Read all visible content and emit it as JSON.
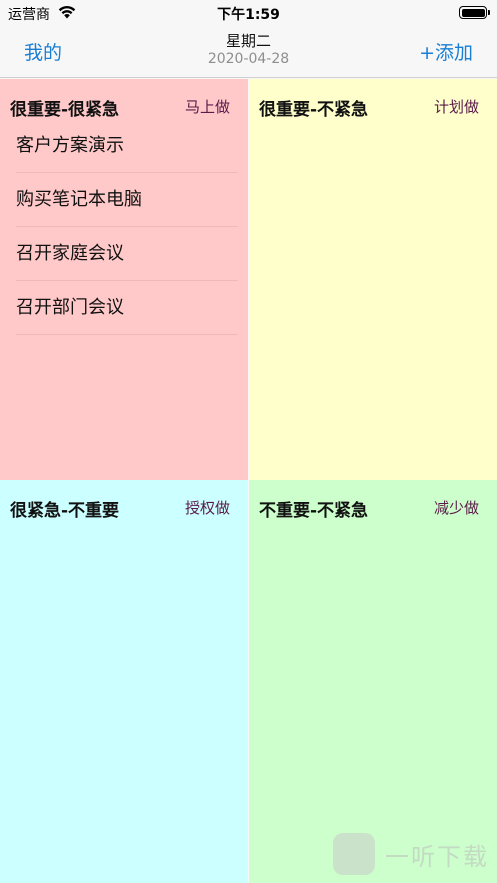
{
  "status_bar": {
    "carrier": "运营商",
    "time": "下午1:59"
  },
  "nav": {
    "left_label": "我的",
    "weekday": "星期二",
    "date": "2020-04-28",
    "right_label": "+添加",
    "link_color": "#1a7fd4"
  },
  "quadrants": [
    {
      "title": "很重要-很紧急",
      "action": "马上做",
      "color": "#ffc9c9",
      "tasks": [
        "客户方案演示",
        "购买笔记本电脑",
        "召开家庭会议",
        "召开部门会议"
      ]
    },
    {
      "title": "很重要-不紧急",
      "action": "计划做",
      "color": "#ffffcc",
      "tasks": []
    },
    {
      "title": "很紧急-不重要",
      "action": "授权做",
      "color": "#ccffff",
      "tasks": []
    },
    {
      "title": "不重要-不紧急",
      "action": "减少做",
      "color": "#ccffcc",
      "tasks": []
    }
  ],
  "watermark": {
    "text": "一听下载"
  }
}
